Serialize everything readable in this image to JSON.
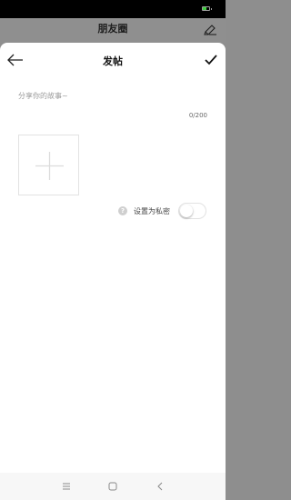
{
  "background": {
    "title": "朋友圈",
    "edit_icon": "edit-icon"
  },
  "sheet": {
    "title": "发帖",
    "back_icon": "back-arrow-icon",
    "confirm_icon": "checkmark-icon",
    "story_placeholder": "分享你的故事~",
    "story_value": "",
    "char_count": "0/200",
    "add_photo_icon": "plus-icon",
    "private_label": "设置为私密",
    "help_icon_glyph": "?",
    "private_enabled": false
  },
  "status_bar": {
    "battery_level": 0.6,
    "battery_color": "#3fce3f"
  },
  "nav_bar": {
    "menu_icon": "menu-icon",
    "home_icon": "home-icon",
    "back_icon": "back-icon"
  },
  "colors": {
    "overlay": "#8e8e8e",
    "sheet": "#ffffff",
    "placeholder": "#9a9a9a"
  }
}
